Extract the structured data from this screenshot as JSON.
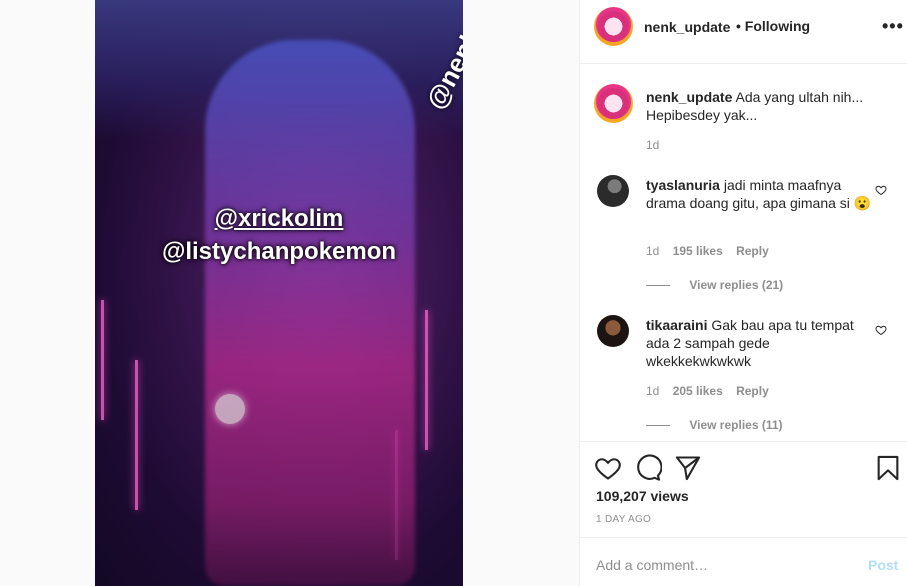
{
  "video": {
    "mention_1": "@xrickolim",
    "mention_2": "@listychanpokemon",
    "watermark": "@nenk_update"
  },
  "header": {
    "username": "nenk_update",
    "follow_label": "• Following",
    "more_icon": "more-horizontal-icon",
    "more_label": "•••"
  },
  "caption": {
    "username": "nenk_update",
    "text": "Ada yang ultah nih... Hepibesdey yak...",
    "time": "1d"
  },
  "comments": [
    {
      "username": "tyaslanuria",
      "text": "jadi minta maafnya drama doang gitu, apa gimana si 😮",
      "time": "1d",
      "likes": "195 likes",
      "reply_label": "Reply",
      "view_replies": "View replies (21)"
    },
    {
      "username": "tikaaraini",
      "text": "Gak bau apa tu tempat ada 2 sampah gede wkekkekwkwkwk",
      "time": "1d",
      "likes": "205 likes",
      "reply_label": "Reply",
      "view_replies": "View replies (11)"
    }
  ],
  "actions": {
    "views": "109,207 views",
    "posted_ago": "1 DAY AGO",
    "icons": [
      "heart-icon",
      "comment-icon",
      "share-icon",
      "bookmark-icon"
    ]
  },
  "comment_box": {
    "placeholder": "Add a comment…",
    "post_label": "Post"
  },
  "colors": {
    "post_disabled": "#b2dffc",
    "meta_gray": "#8e8e8e",
    "text": "#262626"
  }
}
